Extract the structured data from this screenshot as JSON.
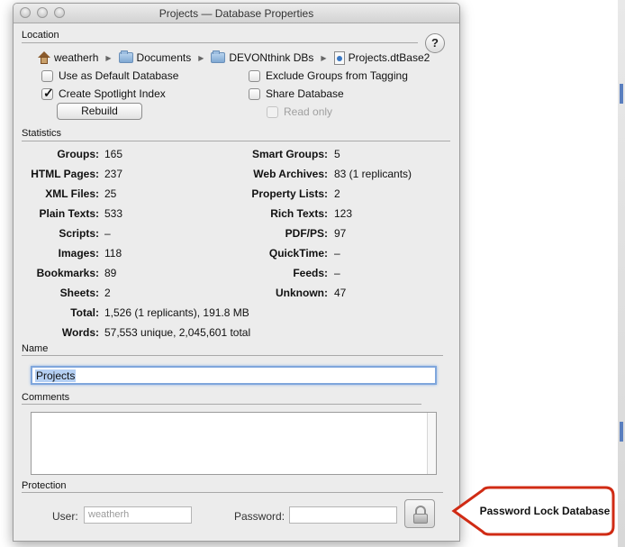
{
  "window": {
    "title": "Projects — Database Properties"
  },
  "location": {
    "section_label": "Location",
    "help_label": "?",
    "path": [
      {
        "label": "weatherh",
        "icon": "home-icon"
      },
      {
        "label": "Documents",
        "icon": "folder-icon"
      },
      {
        "label": "DEVONthink DBs",
        "icon": "folder-icon"
      },
      {
        "label": "Projects.dtBase2",
        "icon": "database-icon"
      }
    ],
    "options": {
      "use_default": {
        "label": "Use as Default Database",
        "checked": false
      },
      "spotlight": {
        "label": "Create Spotlight Index",
        "checked": true
      },
      "exclude_groups": {
        "label": "Exclude Groups from Tagging",
        "checked": false
      },
      "share": {
        "label": "Share Database",
        "checked": false
      },
      "read_only": {
        "label": "Read only",
        "checked": false,
        "enabled": false
      }
    },
    "rebuild_label": "Rebuild"
  },
  "statistics": {
    "section_label": "Statistics",
    "left": [
      {
        "key": "Groups:",
        "value": "165"
      },
      {
        "key": "HTML Pages:",
        "value": "237"
      },
      {
        "key": "XML Files:",
        "value": "25"
      },
      {
        "key": "Plain Texts:",
        "value": "533"
      },
      {
        "key": "Scripts:",
        "value": "–"
      },
      {
        "key": "Images:",
        "value": "118"
      },
      {
        "key": "Bookmarks:",
        "value": "89"
      },
      {
        "key": "Sheets:",
        "value": "2"
      },
      {
        "key": "Total:",
        "value": "1,526 (1 replicants), 191.8 MB"
      },
      {
        "key": "Words:",
        "value": "57,553 unique, 2,045,601 total"
      }
    ],
    "right": [
      {
        "key": "Smart Groups:",
        "value": "5"
      },
      {
        "key": "Web Archives:",
        "value": "83 (1 replicants)"
      },
      {
        "key": "Property Lists:",
        "value": "2"
      },
      {
        "key": "Rich Texts:",
        "value": "123"
      },
      {
        "key": "PDF/PS:",
        "value": "97"
      },
      {
        "key": "QuickTime:",
        "value": "–"
      },
      {
        "key": "Feeds:",
        "value": "–"
      },
      {
        "key": "Unknown:",
        "value": "47"
      }
    ]
  },
  "name": {
    "section_label": "Name",
    "value": "Projects"
  },
  "comments": {
    "section_label": "Comments",
    "value": ""
  },
  "protection": {
    "section_label": "Protection",
    "user_label": "User:",
    "user_placeholder": "weatherh",
    "password_label": "Password:",
    "password_value": ""
  },
  "callout": {
    "text": "Password Lock Database",
    "color": "#d02b14"
  }
}
